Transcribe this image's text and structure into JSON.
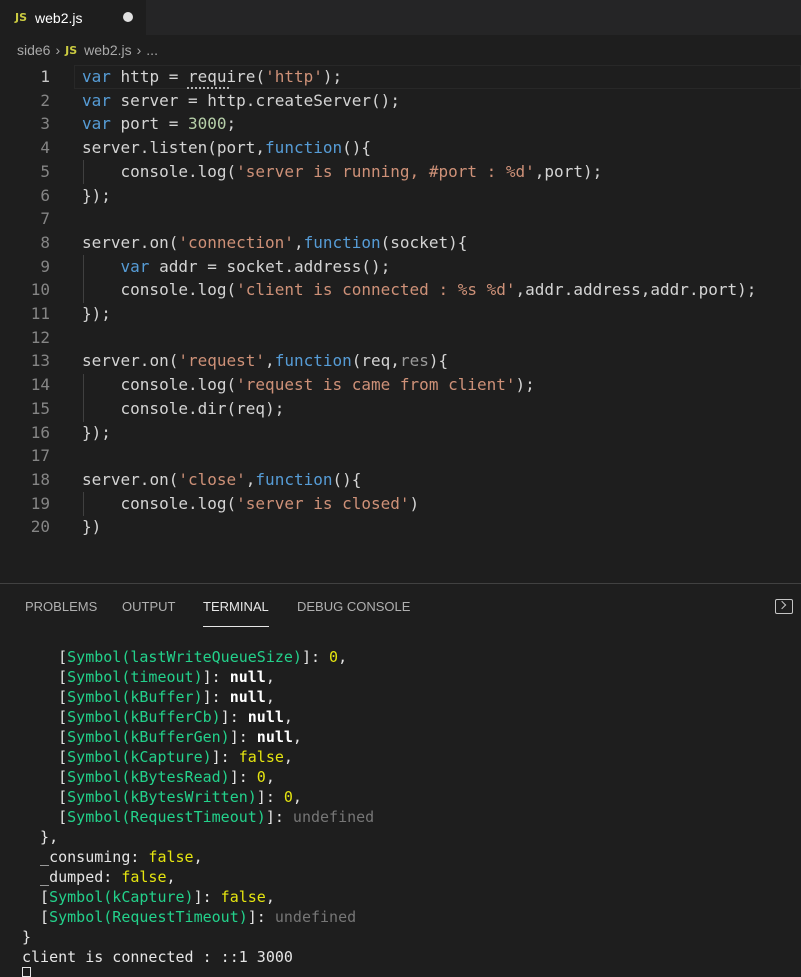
{
  "tab": {
    "icon": "JS",
    "title": "web2.js"
  },
  "breadcrumb": {
    "folder": "side6",
    "file_icon": "JS",
    "file": "web2.js",
    "more": "..."
  },
  "code_lines": [
    "var http = require('http');",
    "var server = http.createServer();",
    "var port = 3000;",
    "server.listen(port,function(){",
    "    console.log('server is running, #port : %d',port);",
    "});",
    "",
    "server.on('connection',function(socket){",
    "    var addr = socket.address();",
    "    console.log('client is connected : %s %d',addr.address,addr.port);",
    "});",
    "",
    "server.on('request',function(req,res){",
    "    console.log('request is came from client');",
    "    console.dir(req);",
    "});",
    "",
    "server.on('close',function(){",
    "    console.log('server is closed')",
    "})"
  ],
  "line_numbers": [
    "1",
    "2",
    "3",
    "4",
    "5",
    "6",
    "7",
    "8",
    "9",
    "10",
    "11",
    "12",
    "13",
    "14",
    "15",
    "16",
    "17",
    "18",
    "19",
    "20"
  ],
  "panel_tabs": [
    "PROBLEMS",
    "OUTPUT",
    "TERMINAL",
    "DEBUG CONSOLE"
  ],
  "terminal": {
    "lines": [
      {
        "indent": 4,
        "sym": "lastWriteQueueSize",
        "value": "0",
        "kind": "num",
        "tail": ","
      },
      {
        "indent": 4,
        "sym": "timeout",
        "value": "null",
        "kind": "null",
        "tail": ","
      },
      {
        "indent": 4,
        "sym": "kBuffer",
        "value": "null",
        "kind": "null",
        "tail": ","
      },
      {
        "indent": 4,
        "sym": "kBufferCb",
        "value": "null",
        "kind": "null",
        "tail": ","
      },
      {
        "indent": 4,
        "sym": "kBufferGen",
        "value": "null",
        "kind": "null",
        "tail": ","
      },
      {
        "indent": 4,
        "sym": "kCapture",
        "value": "false",
        "kind": "false",
        "tail": ","
      },
      {
        "indent": 4,
        "sym": "kBytesRead",
        "value": "0",
        "kind": "num",
        "tail": ","
      },
      {
        "indent": 4,
        "sym": "kBytesWritten",
        "value": "0",
        "kind": "num",
        "tail": ","
      },
      {
        "indent": 4,
        "sym": "RequestTimeout",
        "value": "undefined",
        "kind": "undef",
        "tail": ""
      }
    ],
    "close_inner": "},",
    "consuming": "_consuming",
    "dumped": "_dumped",
    "false_value": "false",
    "req_capture": "kCapture",
    "req_timeout": "RequestTimeout",
    "undefined_value": "undefined",
    "close_outer": "}",
    "last_line": "client is connected : ::1 3000"
  }
}
